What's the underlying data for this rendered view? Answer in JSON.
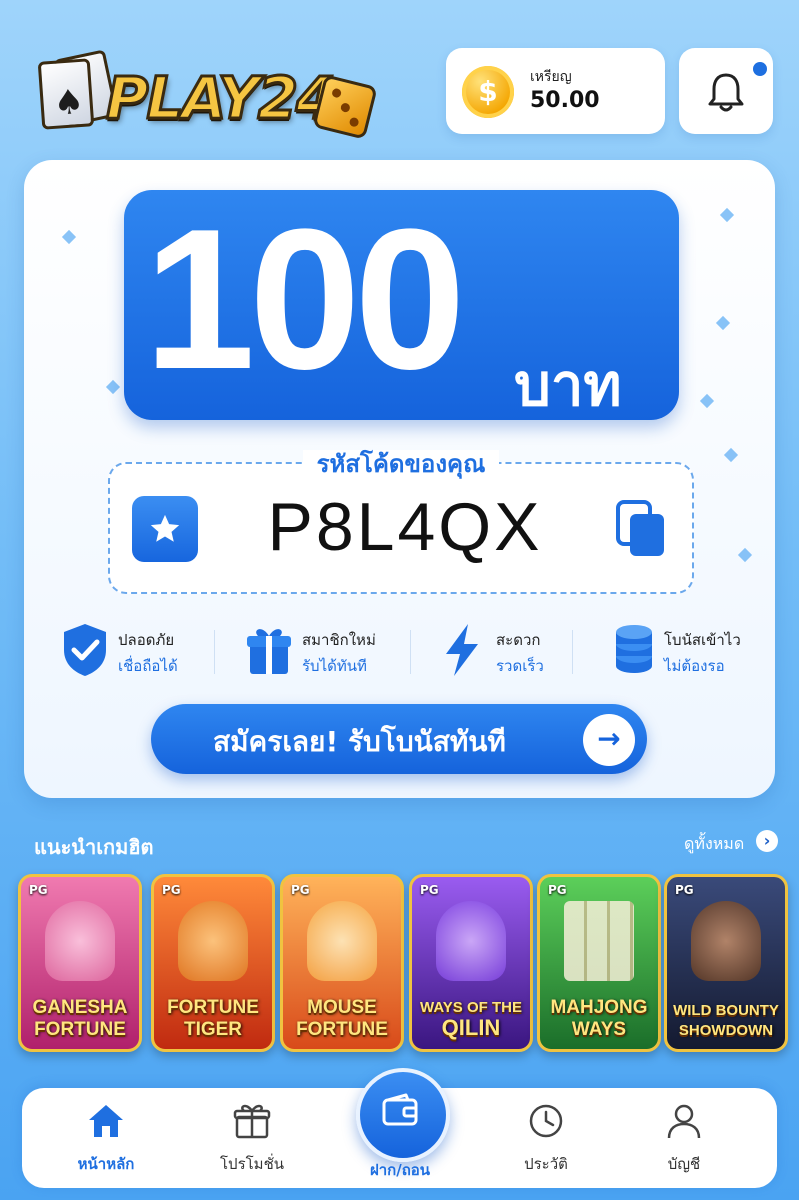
{
  "brand": {
    "logo_text": "PLAY24"
  },
  "header": {
    "coin_label": "เหรียญ",
    "coin_value": "50.00",
    "notification_badge": true
  },
  "promo": {
    "amount": "100",
    "unit": "บาท",
    "code_title": "รหัสโค้ดของคุณ",
    "code_value": "P8L4QX"
  },
  "features": [
    {
      "title": "ปลอดภัย",
      "subtitle": "เชื่อถือได้",
      "icon": "shield-check-icon"
    },
    {
      "title": "สมาชิกใหม่",
      "subtitle": "รับได้ทันที",
      "icon": "gift-icon"
    },
    {
      "title": "สะดวก",
      "subtitle": "รวดเร็ว",
      "icon": "lightning-icon"
    },
    {
      "title": "โบนัสเข้าไว",
      "subtitle": "ไม่ต้องรอ",
      "icon": "coin-stack-icon"
    }
  ],
  "cta": {
    "label": "สมัครเลย!  รับโบนัสทันที"
  },
  "games_section": {
    "title": "แนะนำเกมฮิต",
    "see_all": "ดูทั้งหมด",
    "games": [
      {
        "provider": "PG",
        "name_line1": "GANESHA",
        "name_line2": "FORTUNE"
      },
      {
        "provider": "PG",
        "name_line1": "FORTUNE",
        "name_line2": "TIGER"
      },
      {
        "provider": "PG",
        "name_line1": "MOUSE",
        "name_line2": "FORTUNE"
      },
      {
        "provider": "PG",
        "name_line1": "WAYS OF THE",
        "name_line2": "QILIN"
      },
      {
        "provider": "PG",
        "name_line1": "MAHJONG",
        "name_line2": "WAYS"
      },
      {
        "provider": "PG",
        "name_line1": "WILD BOUNTY",
        "name_line2": "SHOWDOWN"
      }
    ]
  },
  "bottom_nav": {
    "home": "หน้าหลัก",
    "promotions": "โปรโมชั่น",
    "deposit_withdraw": "ฝาก/ถอน",
    "history": "ประวัติ",
    "account": "บัญชี"
  },
  "colors": {
    "primary": "#1f6fe0",
    "accent_gold": "#f0c340"
  }
}
